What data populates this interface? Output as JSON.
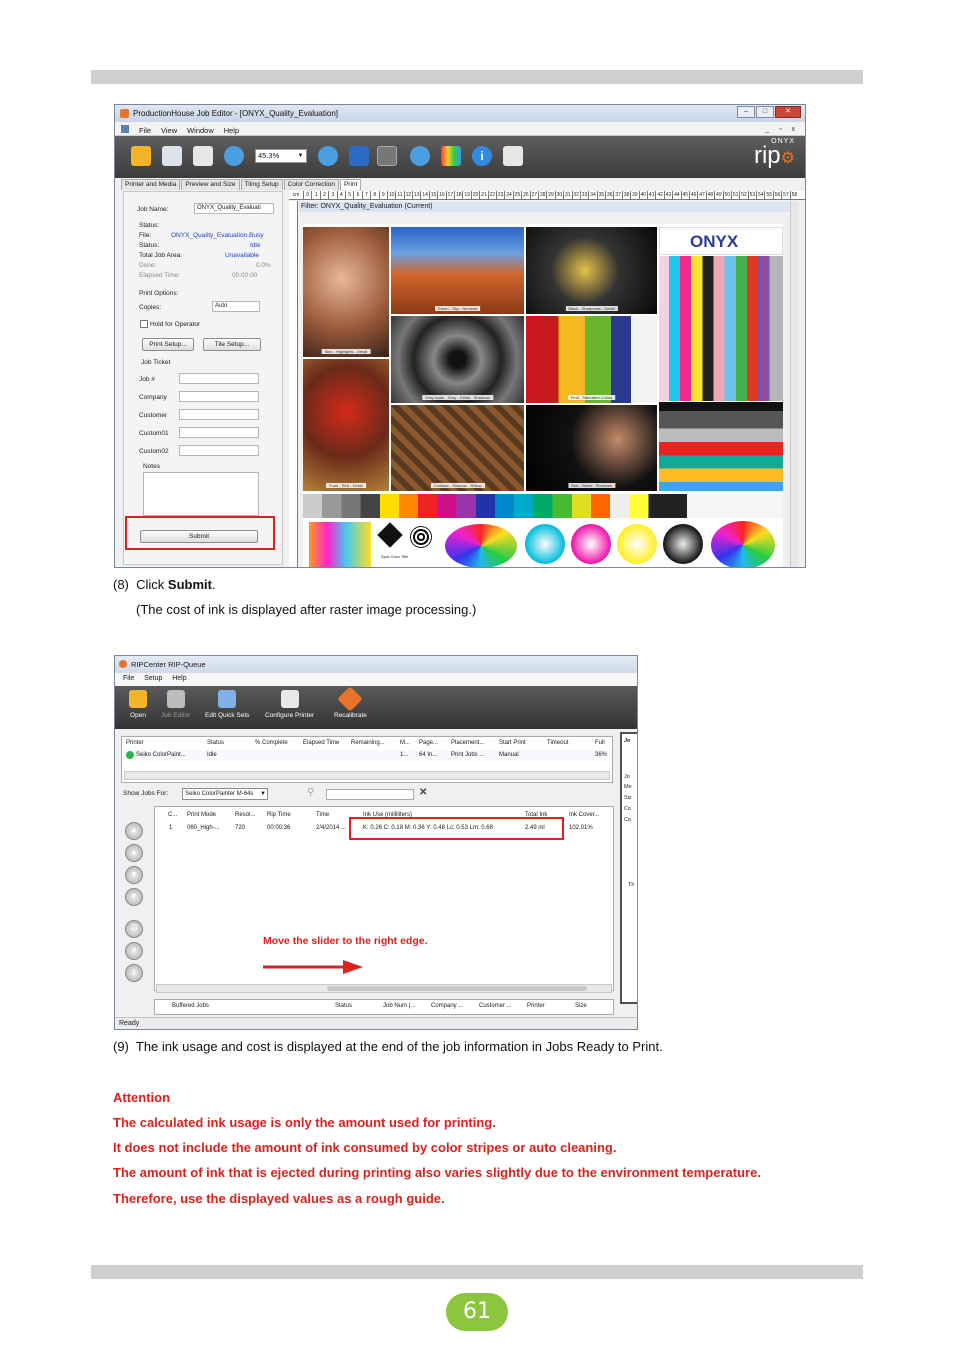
{
  "page": {
    "number": "61",
    "accent_color": "#8cc63f",
    "alert_color": "#e0201c"
  },
  "job_editor": {
    "title": "ProductionHouse Job Editor - [ONYX_Quality_Evaluation]",
    "menu": [
      "File",
      "View",
      "Window",
      "Help"
    ],
    "window_controls": [
      "–",
      "□",
      "✕"
    ],
    "mdi_controls": "_ ▫ x",
    "zoom": "45.3%",
    "brand_small": "ONYX",
    "brand_big": "rip",
    "tabs": [
      "Printer and Media",
      "Preview and Size",
      "Tiling Setup",
      "Color Correction",
      "Print"
    ],
    "ruler_unit": "cm",
    "filter": "Filter: ONYX_Quality_Evaluation (Current)",
    "job_name_label": "Job Name:",
    "job_name_value": "ONYX_Quality_Evaluati",
    "status_header": "Status:",
    "file_label": "File:",
    "file_value": "ONYX_Quality_Evaluation.Busy",
    "status_label": "Status:",
    "status_value": "Idle",
    "total_job_area_label": "Total Job Area:",
    "total_job_area_value": "Unavailable",
    "done_label": "Done:",
    "done_value": "0.0%",
    "elapsed_label": "Elapsed Time:",
    "elapsed_value": "00:00:00",
    "print_options_label": "Print Options:",
    "copies_label": "Copies:",
    "copies_value": "Auto",
    "hold_label": "Hold for Operator",
    "print_setup_button": "Print Setup...",
    "tile_setup_button": "Tile Setup...",
    "job_ticket_label": "Job Ticket",
    "job_no_label": "Job #",
    "company_label": "Company",
    "customer_label": "Customer",
    "custom01_label": "Custom01",
    "custom02_label": "Custom02",
    "notes_label": "Notes",
    "submit_button": "Submit",
    "image_captions": [
      "Skin - Highlights - Detail",
      "Green - Sky - Neutrals",
      "Black - Sharpness - Detail",
      "Gray-scale - Gray - Detail - Shadows",
      "Food - Red - Detail",
      "Neutrals",
      "Fruit - Saturated Colors",
      "Contrast - Shadow - Yellow",
      "Skin - Black - Shadows"
    ],
    "target_logo": "ONYX",
    "target_label": "Spot Color Title"
  },
  "step8": {
    "number": "(8)",
    "prefix": "Click",
    "bold": "Submit",
    "suffix": ".",
    "note": "(The cost of ink is displayed after raster image processing.)"
  },
  "rip_queue": {
    "title": "RIPCenter RIP-Queue",
    "menu": [
      "File",
      "Setup",
      "Help"
    ],
    "tools": [
      {
        "label": "Open",
        "icon": "folder-icon",
        "enabled": true
      },
      {
        "label": "Job Editor",
        "icon": "job-editor-icon",
        "enabled": false
      },
      {
        "label": "Edit Quick Sets",
        "icon": "quick-sets-icon",
        "enabled": true
      },
      {
        "label": "Configure Printer",
        "icon": "printer-icon",
        "enabled": true
      },
      {
        "label": "Recalibrate",
        "icon": "recalibrate-icon",
        "enabled": true
      }
    ],
    "printer_columns": [
      "Printer",
      "Status",
      "% Complete",
      "Elapsed Time",
      "Remaining...",
      "M...",
      "Page...",
      "Placement...",
      "Start Print",
      "Timeout",
      "Full"
    ],
    "printer_row": [
      "Seiko ColorPaint...",
      "Idle",
      "",
      "",
      "",
      "1...",
      "64 In...",
      "Print Jobs ...",
      "Manual",
      "",
      "36%"
    ],
    "show_jobs_label": "Show Jobs For:",
    "show_jobs_value": "Seiko ColorPainter M-64s",
    "job_columns": [
      "C...",
      "Print Mode",
      "Resol...",
      "Rip Time",
      "Time",
      "Ink Use (milliliters)",
      "Total Ink",
      "Ink Cover..."
    ],
    "job_row": [
      "1",
      "060_High-...",
      "720",
      "00:00:36",
      "2/4/2014 ...",
      "K: 0.26 C: 0.18 M: 0.36 Y: 0.48 Lc: 0.53 Lm: 0.68",
      "2.49 ml",
      "102.01%"
    ],
    "annotation": "Move the slider to the right edge.",
    "buffered_columns": [
      "Buffered Jobs",
      "Status",
      "Job Num (...",
      "Company ...",
      "Customer ...",
      "Printer",
      "Size"
    ],
    "status": "Ready",
    "side_panel_letters": [
      "Jo",
      "Jo",
      "Me",
      "Siz",
      "Co",
      "Co",
      "Th"
    ]
  },
  "step9": {
    "number": "(9)",
    "text": "The ink usage and cost is displayed at the end of the job information in Jobs Ready to Print."
  },
  "attention": {
    "heading": "Attention",
    "lines": [
      "The calculated ink usage is only the amount used for printing.",
      "It does not include the amount of ink consumed by color stripes or auto cleaning.",
      "The amount of ink that is ejected during printing also varies slightly due to the environment temperature.",
      "Therefore, use the displayed values as a rough guide."
    ]
  }
}
